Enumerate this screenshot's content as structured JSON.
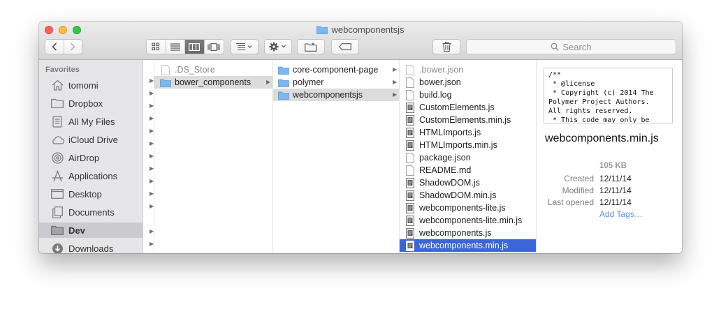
{
  "window": {
    "title": "webcomponentsjs"
  },
  "search": {
    "placeholder": "Search"
  },
  "sidebar": {
    "heading": "Favorites",
    "items": [
      {
        "label": "tomomi",
        "icon": "home-icon"
      },
      {
        "label": "Dropbox",
        "icon": "folder-icon"
      },
      {
        "label": "All My Files",
        "icon": "all-files-icon"
      },
      {
        "label": "iCloud Drive",
        "icon": "cloud-icon"
      },
      {
        "label": "AirDrop",
        "icon": "airdrop-icon"
      },
      {
        "label": "Applications",
        "icon": "applications-icon"
      },
      {
        "label": "Desktop",
        "icon": "desktop-icon"
      },
      {
        "label": "Documents",
        "icon": "documents-icon"
      },
      {
        "label": "Dev",
        "icon": "folder-icon",
        "selected": true
      },
      {
        "label": "Downloads",
        "icon": "downloads-icon"
      }
    ]
  },
  "columns": {
    "col1": [
      {
        "name": ".DS_Store",
        "type": "file",
        "dim": true
      },
      {
        "name": "bower_components",
        "type": "folder",
        "state": "inactive"
      }
    ],
    "col2": [
      {
        "name": "core-component-page",
        "type": "folder"
      },
      {
        "name": "polymer",
        "type": "folder"
      },
      {
        "name": "webcomponentsjs",
        "type": "folder",
        "state": "inactive"
      }
    ],
    "col3": [
      {
        "name": ".bower.json",
        "type": "file",
        "dim": true
      },
      {
        "name": "bower.json",
        "type": "file"
      },
      {
        "name": "build.log",
        "type": "file"
      },
      {
        "name": "CustomElements.js",
        "type": "script"
      },
      {
        "name": "CustomElements.min.js",
        "type": "script"
      },
      {
        "name": "HTMLImports.js",
        "type": "script"
      },
      {
        "name": "HTMLImports.min.js",
        "type": "script"
      },
      {
        "name": "package.json",
        "type": "file"
      },
      {
        "name": "README.md",
        "type": "file"
      },
      {
        "name": "ShadowDOM.js",
        "type": "script"
      },
      {
        "name": "ShadowDOM.min.js",
        "type": "script"
      },
      {
        "name": "webcomponents-lite.js",
        "type": "script"
      },
      {
        "name": "webcomponents-lite.min.js",
        "type": "script"
      },
      {
        "name": "webcomponents.js",
        "type": "script"
      },
      {
        "name": "webcomponents.min.js",
        "type": "script",
        "state": "active"
      }
    ]
  },
  "preview": {
    "code": "/**\n * @license\n * Copyright (c) 2014 The\nPolymer Project Authors.\nAll rights reserved.\n * This code may only be\n   used under the BSD style",
    "file_name": "webcomponents.min.js",
    "size": "105 KB",
    "meta": [
      {
        "label": "Created",
        "value": "12/11/14"
      },
      {
        "label": "Modified",
        "value": "12/11/14"
      },
      {
        "label": "Last opened",
        "value": "12/11/14"
      }
    ],
    "add_tags": "Add Tags…"
  },
  "colors": {
    "selection": "#3a66d9",
    "folder": "#7cb9ee",
    "link": "#5b8ee6"
  }
}
